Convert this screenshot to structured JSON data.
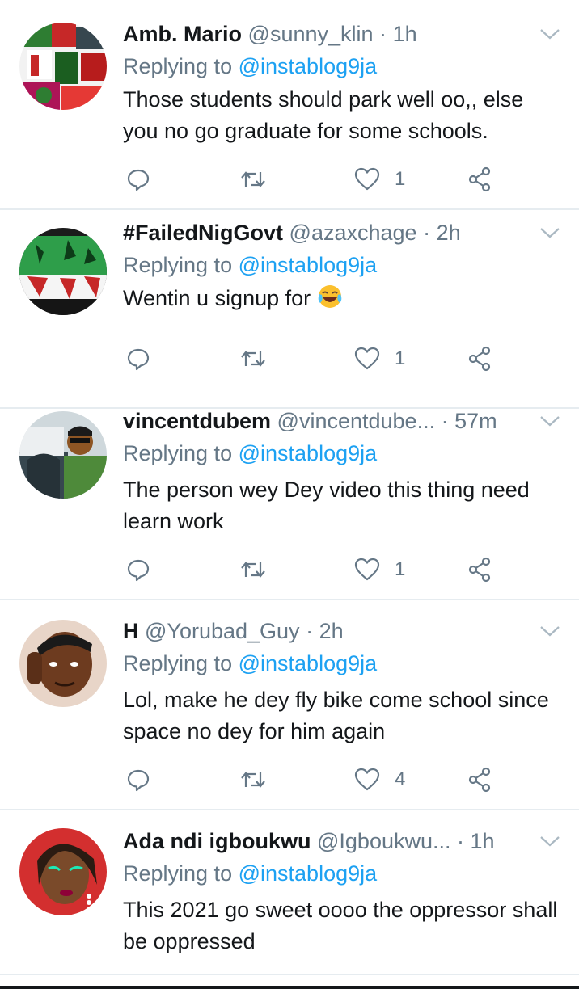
{
  "reply_prefix": "Replying to",
  "colors": {
    "accent": "#1da1f2",
    "secondary_text": "#657786",
    "divider": "#e6ecf0"
  },
  "tweets": [
    {
      "name": "Amb. Mario",
      "handle": "@sunny_klin",
      "separator": "·",
      "time": "1h",
      "replying_to": "@instablog9ja",
      "text": "Those students should park well oo,, else you no go graduate for some schools.",
      "like_count": "1"
    },
    {
      "name": "#FailedNigGovt",
      "handle": "@azaxchage",
      "separator": "·",
      "time": "2h",
      "replying_to": "@instablog9ja",
      "text": "Wentin u signup for",
      "emoji": "face-with-tears-of-joy",
      "like_count": "1"
    },
    {
      "name": "vincentdubem",
      "handle": "@vincentdube...",
      "separator": "·",
      "time": "57m",
      "replying_to": "@instablog9ja",
      "text": "The person wey Dey video this thing need learn work",
      "like_count": "1"
    },
    {
      "name": "H",
      "handle": "@Yorubad_Guy",
      "separator": "·",
      "time": "2h",
      "replying_to": "@instablog9ja",
      "text": "Lol, make he dey fly bike come school since space no dey for him again",
      "like_count": "4"
    },
    {
      "name": "Ada ndi igboukwu",
      "handle": "@Igboukwu...",
      "separator": "·",
      "time": "1h",
      "replying_to": "@instablog9ja",
      "text": "This 2021 go sweet oooo the oppressor shall be oppressed"
    }
  ]
}
